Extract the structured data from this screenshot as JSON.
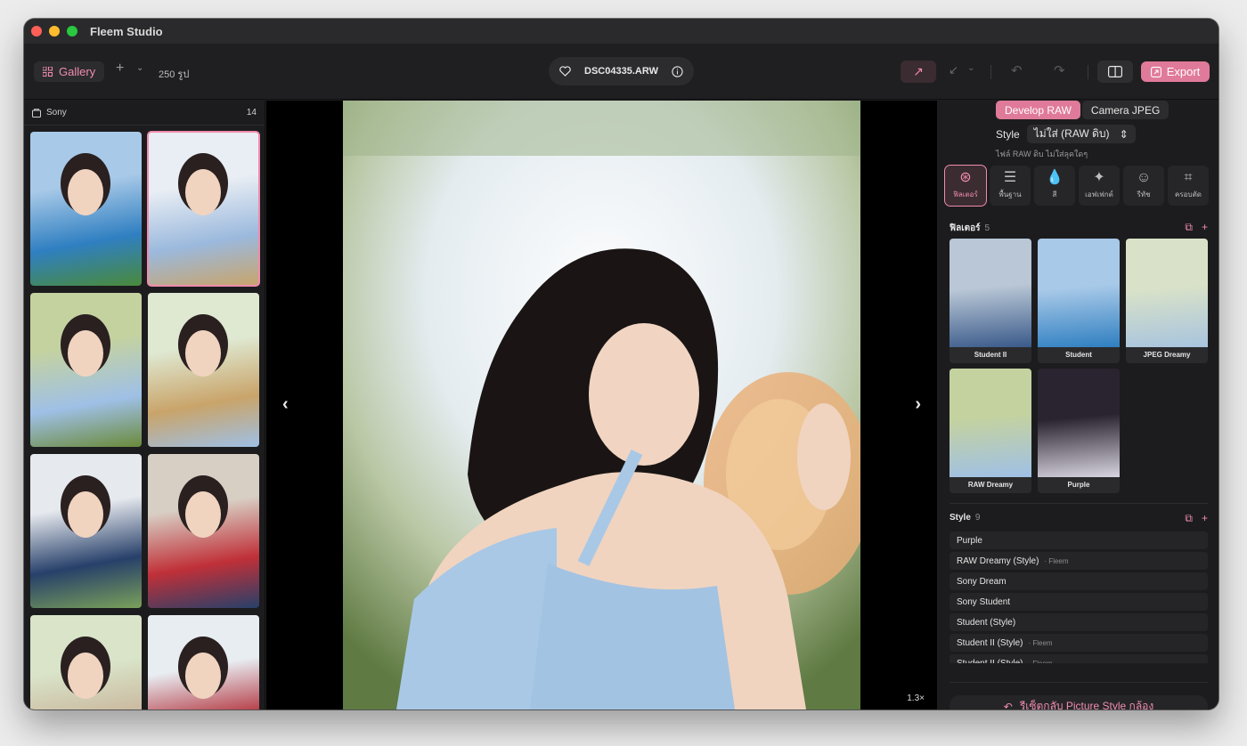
{
  "window": {
    "title": "Fleem Studio"
  },
  "toolbar": {
    "gallery_label": "Gallery",
    "photo_count": "250 รูป",
    "filename": "DSC04335.ARW",
    "export_label": "Export"
  },
  "left": {
    "folder_name": "Sony",
    "folder_count": "14",
    "thumbnails": [
      {
        "colors": [
          "#a8c9e8",
          "#2f7fc1",
          "#4a8a3a"
        ]
      },
      {
        "colors": [
          "#e9eef4",
          "#9bb9dd",
          "#c9a46a"
        ]
      },
      {
        "colors": [
          "#c4d2a0",
          "#9fc0e6",
          "#6a8a3a"
        ]
      },
      {
        "colors": [
          "#dfe9d2",
          "#c9a46a",
          "#9fc0e6"
        ]
      },
      {
        "colors": [
          "#e6e9ee",
          "#27406a",
          "#7aa05a"
        ]
      },
      {
        "colors": [
          "#d8cfc4",
          "#c03038",
          "#27406a"
        ]
      },
      {
        "colors": [
          "#d9e4c9",
          "#c8b49a",
          "#90b070"
        ]
      },
      {
        "colors": [
          "#e8edf2",
          "#b02a34",
          "#a8c4de"
        ]
      }
    ]
  },
  "viewer": {
    "zoom": "1.3×"
  },
  "right": {
    "seg_develop": "Develop RAW",
    "seg_jpeg": "Camera JPEG",
    "style_label": "Style",
    "style_value": "ไม่ใส่ (RAW ดิบ)",
    "style_hint": "ไฟล์ RAW ดิบ ไม่ใส่ลุคใดๆ",
    "tools": [
      {
        "icon": "filter-icon",
        "label": "ฟิลเตอร์",
        "glyph": "⊛"
      },
      {
        "icon": "sliders-icon",
        "label": "พื้นฐาน",
        "glyph": "☰"
      },
      {
        "icon": "drop-icon",
        "label": "สี",
        "glyph": "💧"
      },
      {
        "icon": "sparkle-icon",
        "label": "เอฟเฟกต์",
        "glyph": "✦"
      },
      {
        "icon": "retouch-icon",
        "label": "รีทัช",
        "glyph": "☺"
      },
      {
        "icon": "crop-icon",
        "label": "ครอบตัด",
        "glyph": "⌗"
      }
    ],
    "filters_title": "ฟิลเตอร์",
    "filters_count": "5",
    "filters": [
      {
        "label": "Student II",
        "colors": [
          "#b9c7d6",
          "#3a5a8a"
        ]
      },
      {
        "label": "Student",
        "colors": [
          "#a8c9e8",
          "#2f7fc1"
        ]
      },
      {
        "label": "JPEG Dreamy",
        "colors": [
          "#d9e2c8",
          "#a8c4de"
        ]
      },
      {
        "label": "RAW Dreamy",
        "colors": [
          "#c4d2a0",
          "#9fc0e6"
        ]
      },
      {
        "label": "Purple",
        "colors": [
          "#2a2430",
          "#d8d4e0"
        ]
      }
    ],
    "style_section_title": "Style",
    "style_count": "9",
    "styles": [
      {
        "name": "Purple",
        "tag": ""
      },
      {
        "name": "RAW Dreamy (Style)",
        "tag": "· Fleem"
      },
      {
        "name": "Sony Dream",
        "tag": ""
      },
      {
        "name": "Sony Student",
        "tag": ""
      },
      {
        "name": "Student (Style)",
        "tag": ""
      },
      {
        "name": "Student II (Style)",
        "tag": "· Fleem"
      },
      {
        "name": "Student II (Style)",
        "tag": "· Fleem"
      }
    ],
    "reset_label": "รีเซ็ตกลับ Picture Style กล้อง"
  }
}
